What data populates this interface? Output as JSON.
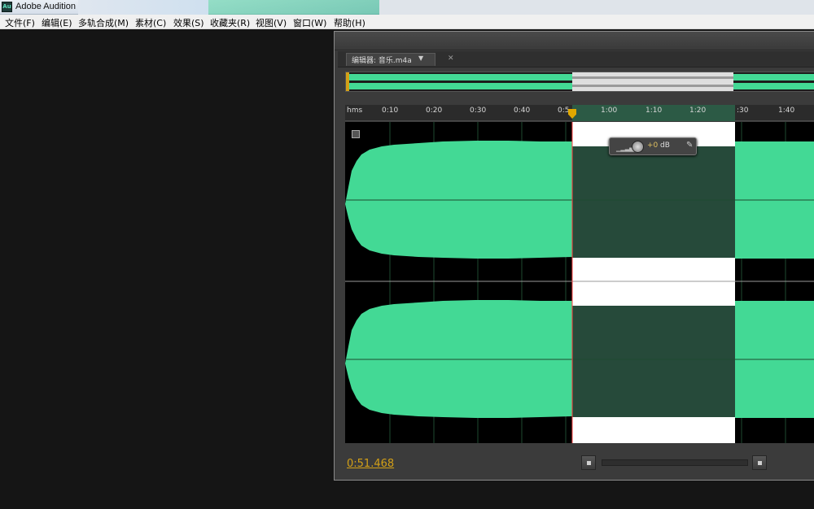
{
  "window": {
    "app_icon_text": "Au",
    "title": "Adobe Audition"
  },
  "menu": [
    "文件(F)",
    "编辑(E)",
    "多轨合成(M)",
    "素材(C)",
    "效果(S)",
    "收藏夹(R)",
    "视图(V)",
    "窗口(W)",
    "帮助(H)"
  ],
  "editor": {
    "tab_label": "编辑器: 音乐.m4a",
    "time_units": "hms",
    "ruler_ticks": [
      "0:10",
      "0:20",
      "0:30",
      "0:40",
      "0:5",
      "1:00",
      "1:10",
      "1:20",
      ":30",
      "1:40"
    ],
    "hud": {
      "gain_value": "+0",
      "gain_unit": "dB"
    },
    "current_time": "0:51.468"
  },
  "colors": {
    "waveform": "#43d995",
    "waveform_selected_dim": "#264a3a",
    "selection_bg": "#ffffff",
    "time_text": "#d3a017",
    "ruler_selection": "#2c5a45"
  },
  "icons": {
    "tab_dropdown": "dropdown-icon",
    "tab_close": "close-icon",
    "hud_gain_knob": "gain-knob-icon",
    "hud_pin": "pin-icon",
    "channel_toggle": "channel-toggle-icon",
    "stop": "stop-icon"
  }
}
